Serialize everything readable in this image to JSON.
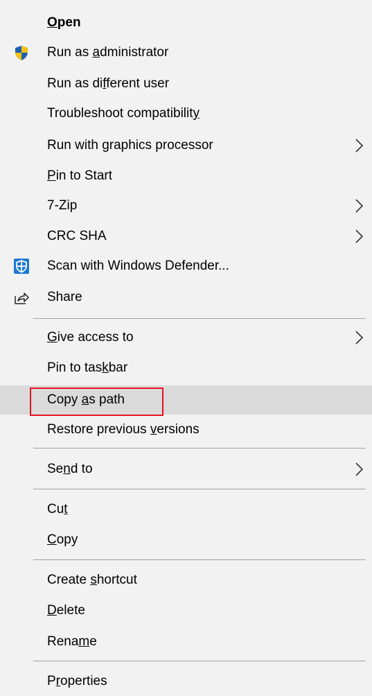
{
  "colors": {
    "background": "#f2f2f2",
    "highlight": "#dadada",
    "separator": "#a0a0a0",
    "annotation": "#e81123",
    "shield_blue": "#1f5fb4",
    "shield_yellow": "#f5c211",
    "defender_blue": "#1e78d6"
  },
  "menu": {
    "items": [
      {
        "label_parts": [
          {
            "t": "O",
            "u": true
          },
          {
            "t": "pen"
          }
        ],
        "label": "Open",
        "bold": true
      },
      {
        "label_parts": [
          {
            "t": "Run as "
          },
          {
            "t": "a",
            "u": true
          },
          {
            "t": "dministrator"
          }
        ],
        "label": "Run as administrator",
        "icon": "uac-shield-icon"
      },
      {
        "label_parts": [
          {
            "t": "Run as di"
          },
          {
            "t": "f",
            "u": true
          },
          {
            "t": "ferent user"
          }
        ],
        "label": "Run as different user"
      },
      {
        "label_parts": [
          {
            "t": "Troubleshoot compatibilit"
          },
          {
            "t": "y",
            "u": true
          }
        ],
        "label": "Troubleshoot compatibility"
      },
      {
        "label_parts": [
          {
            "t": "Run with graphics processor"
          }
        ],
        "label": "Run with graphics processor",
        "submenu": true
      },
      {
        "label_parts": [
          {
            "t": "P",
            "u": true
          },
          {
            "t": "in to Start"
          }
        ],
        "label": "Pin to Start"
      },
      {
        "label_parts": [
          {
            "t": "7-Zip"
          }
        ],
        "label": "7-Zip",
        "submenu": true
      },
      {
        "label_parts": [
          {
            "t": "CRC SHA"
          }
        ],
        "label": "CRC SHA",
        "submenu": true
      },
      {
        "label_parts": [
          {
            "t": "Scan with Windows Defender..."
          }
        ],
        "label": "Scan with Windows Defender...",
        "icon": "windows-defender-icon"
      },
      {
        "label_parts": [
          {
            "t": "Share"
          }
        ],
        "label": "Share",
        "icon": "share-icon"
      },
      {
        "label_parts": [
          {
            "t": "G",
            "u": true
          },
          {
            "t": "ive access to"
          }
        ],
        "label": "Give access to",
        "submenu": true
      },
      {
        "label_parts": [
          {
            "t": "Pin to tas"
          },
          {
            "t": "k",
            "u": true
          },
          {
            "t": "bar"
          }
        ],
        "label": "Pin to taskbar"
      },
      {
        "label_parts": [
          {
            "t": "Copy "
          },
          {
            "t": "a",
            "u": true
          },
          {
            "t": "s path"
          }
        ],
        "label": "Copy as path",
        "highlighted": true
      },
      {
        "label_parts": [
          {
            "t": "Restore previous "
          },
          {
            "t": "v",
            "u": true
          },
          {
            "t": "ersions"
          }
        ],
        "label": "Restore previous versions"
      },
      {
        "label_parts": [
          {
            "t": "Se"
          },
          {
            "t": "n",
            "u": true
          },
          {
            "t": "d to"
          }
        ],
        "label": "Send to",
        "submenu": true
      },
      {
        "label_parts": [
          {
            "t": "Cu"
          },
          {
            "t": "t",
            "u": true
          }
        ],
        "label": "Cut"
      },
      {
        "label_parts": [
          {
            "t": "C",
            "u": true
          },
          {
            "t": "opy"
          }
        ],
        "label": "Copy"
      },
      {
        "label_parts": [
          {
            "t": "Create "
          },
          {
            "t": "s",
            "u": true
          },
          {
            "t": "hortcut"
          }
        ],
        "label": "Create shortcut"
      },
      {
        "label_parts": [
          {
            "t": "D",
            "u": true
          },
          {
            "t": "elete"
          }
        ],
        "label": "Delete"
      },
      {
        "label_parts": [
          {
            "t": "Rena"
          },
          {
            "t": "m",
            "u": true
          },
          {
            "t": "e"
          }
        ],
        "label": "Rename"
      },
      {
        "label_parts": [
          {
            "t": "P"
          },
          {
            "t": "r",
            "u": true
          },
          {
            "t": "operties"
          }
        ],
        "label": "Properties"
      }
    ]
  }
}
